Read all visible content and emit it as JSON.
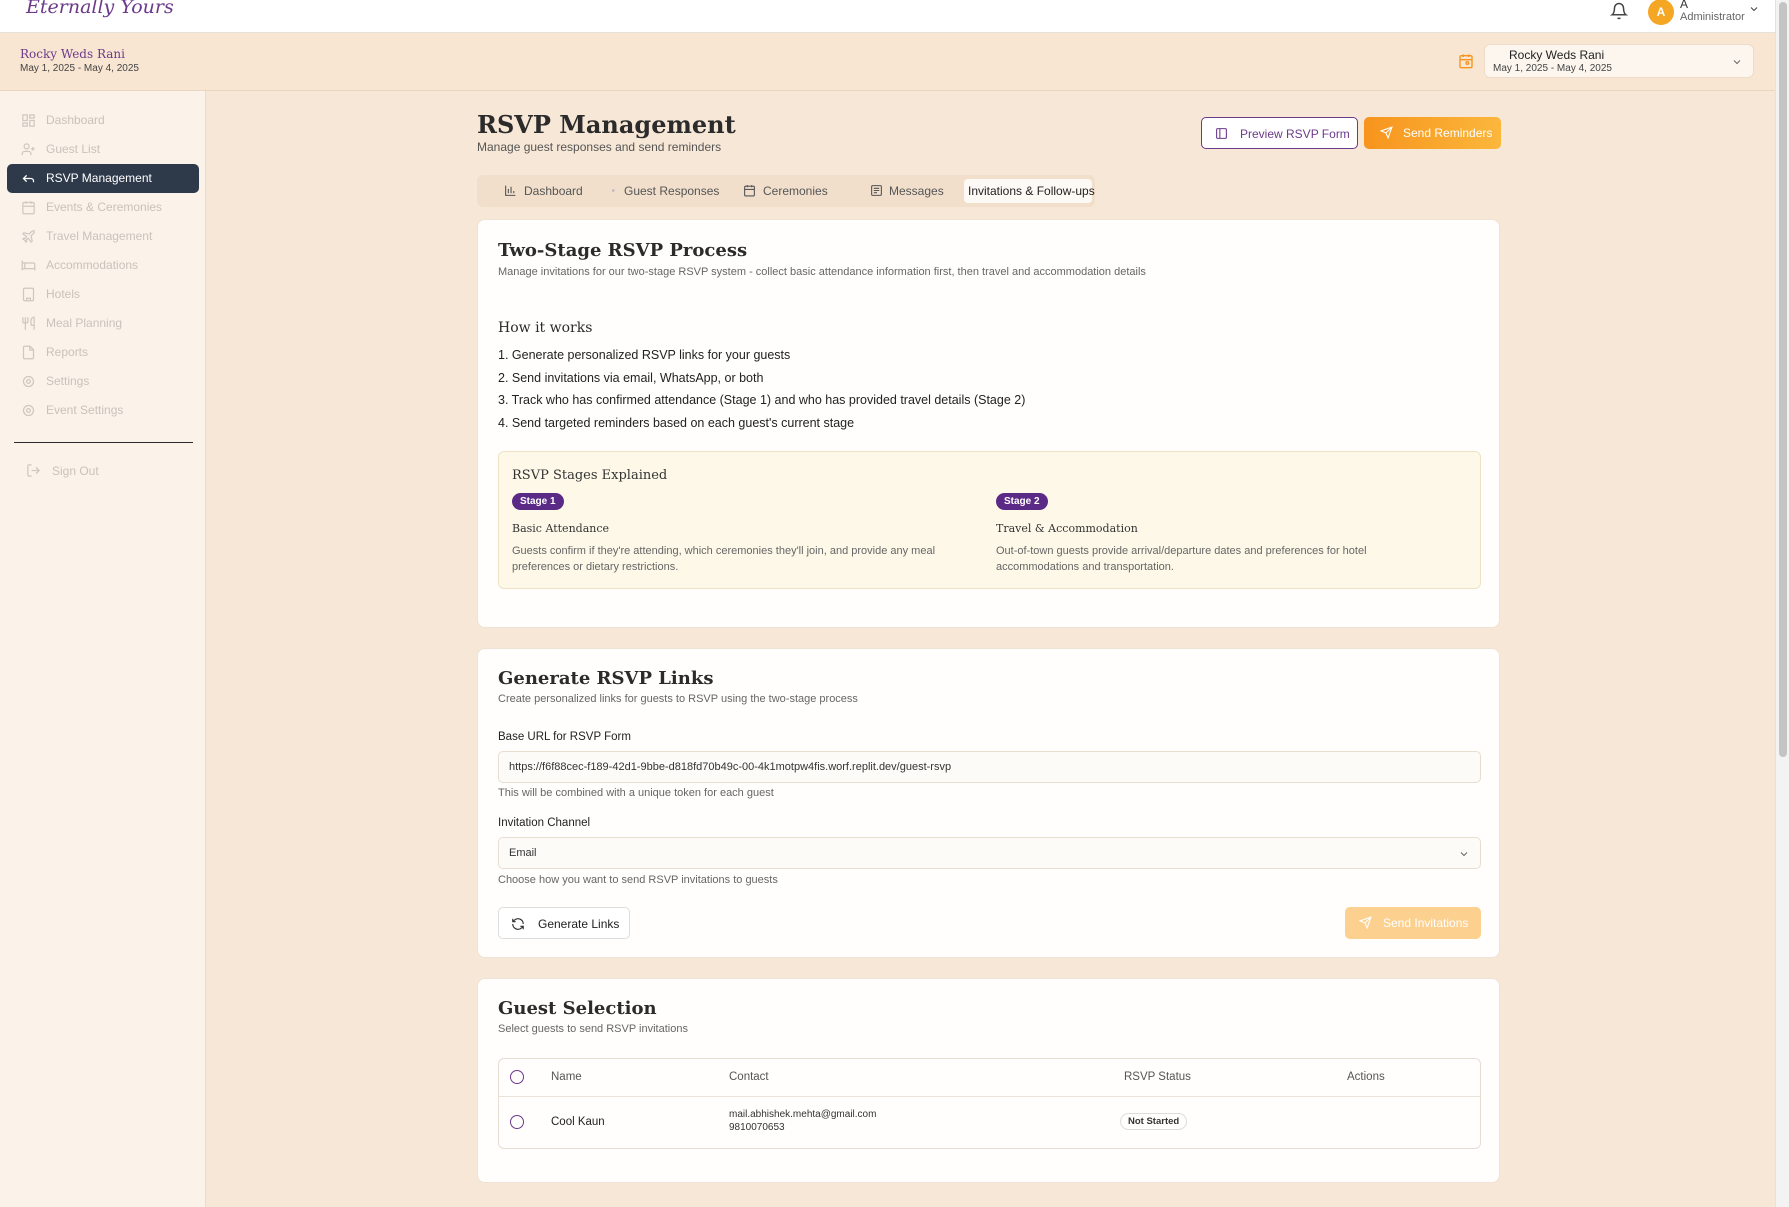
{
  "app": {
    "logo": "Eternally Yours"
  },
  "user": {
    "initial": "A",
    "name": "A",
    "role": "Administrator"
  },
  "event": {
    "name": "Rocky Weds Rani",
    "dates": "May 1, 2025 - May 4, 2025"
  },
  "event_selector": {
    "name": "Rocky Weds Rani",
    "dates": "May 1, 2025 - May 4, 2025"
  },
  "sidebar": {
    "items": [
      {
        "label": "Dashboard",
        "icon": "dashboard-icon"
      },
      {
        "label": "Guest List",
        "icon": "users-icon"
      },
      {
        "label": "RSVP Management",
        "icon": "reply-icon",
        "active": true
      },
      {
        "label": "Events & Ceremonies",
        "icon": "calendar-icon"
      },
      {
        "label": "Travel Management",
        "icon": "plane-icon"
      },
      {
        "label": "Accommodations",
        "icon": "bed-icon"
      },
      {
        "label": "Hotels",
        "icon": "building-icon"
      },
      {
        "label": "Meal Planning",
        "icon": "utensils-icon"
      },
      {
        "label": "Reports",
        "icon": "file-icon"
      },
      {
        "label": "Settings",
        "icon": "gear-icon"
      },
      {
        "label": "Event Settings",
        "icon": "gear-icon"
      }
    ],
    "signout": "Sign Out"
  },
  "page": {
    "title": "RSVP Management",
    "subtitle": "Manage guest responses and send reminders",
    "preview_button": "Preview RSVP Form",
    "reminders_button": "Send Reminders"
  },
  "tabs": [
    {
      "label": "Dashboard",
      "icon": "bar-chart-icon"
    },
    {
      "label": "Guest Responses",
      "icon": "dot-icon"
    },
    {
      "label": "Ceremonies",
      "icon": "calendar-icon"
    },
    {
      "label": "Messages",
      "icon": "message-icon"
    },
    {
      "label": "Invitations & Follow-ups",
      "active": true
    }
  ],
  "process": {
    "title": "Two-Stage RSVP Process",
    "subtitle": "Manage invitations for our two-stage RSVP system - collect basic attendance information first, then travel and accommodation details",
    "how_title": "How it works",
    "steps": [
      "1. Generate personalized RSVP links for your guests",
      "2. Send invitations via email, WhatsApp, or both",
      "3. Track who has confirmed attendance (Stage 1) and who has provided travel details (Stage 2)",
      "4. Send targeted reminders based on each guest's current stage"
    ],
    "stages_title": "RSVP Stages Explained",
    "stage1": {
      "badge": "Stage 1",
      "title": "Basic Attendance",
      "desc": "Guests confirm if they're attending, which ceremonies they'll join, and provide any meal preferences or dietary restrictions."
    },
    "stage2": {
      "badge": "Stage 2",
      "title": "Travel & Accommodation",
      "desc": "Out-of-town guests provide arrival/departure dates and preferences for hotel accommodations and transportation."
    }
  },
  "links": {
    "title": "Generate RSVP Links",
    "subtitle": "Create personalized links for guests to RSVP using the two-stage process",
    "base_url_label": "Base URL for RSVP Form",
    "base_url_value": "https://f6f88cec-f189-42d1-9bbe-d818fd70b49c-00-4k1motpw4fis.worf.replit.dev/guest-rsvp",
    "base_url_help": "This will be combined with a unique token for each guest",
    "channel_label": "Invitation Channel",
    "channel_value": "Email",
    "channel_help": "Choose how you want to send RSVP invitations to guests",
    "generate_button": "Generate Links",
    "send_button": "Send Invitations"
  },
  "guests": {
    "title": "Guest Selection",
    "subtitle": "Select guests to send RSVP invitations",
    "columns": [
      "Name",
      "Contact",
      "RSVP Status",
      "Actions"
    ],
    "rows": [
      {
        "name": "Cool Kaun",
        "email": "mail.abhishek.mehta@gmail.com",
        "phone": "9810070653",
        "status": "Not Started"
      }
    ]
  },
  "colors": {
    "accent_purple": "#6b3a8a",
    "accent_orange": "#f7941d",
    "sidebar_active": "#2e3a4a",
    "background": "#f7e7d6"
  }
}
